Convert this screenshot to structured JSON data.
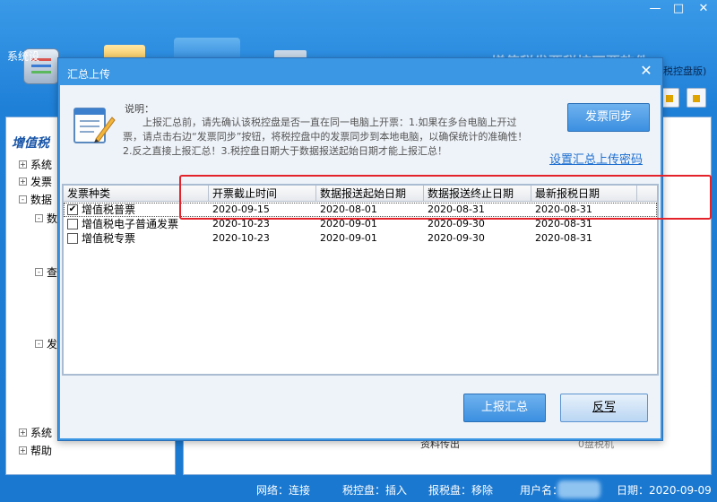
{
  "app": {
    "window_controls": [
      "—",
      "□",
      "✕"
    ],
    "toolbar": {
      "settings_label": "系统设"
    },
    "title": "增值税发票税控开票软件",
    "subtitle": "税控盘版)",
    "left_panel": {
      "heading": "增值税",
      "tree": [
        {
          "toggle": "+",
          "label": "系统"
        },
        {
          "toggle": "+",
          "label": "发票"
        },
        {
          "toggle": "-",
          "label": "数据"
        },
        {
          "toggle": "-",
          "label": "数"
        },
        {
          "toggle": "-",
          "label": "查"
        },
        {
          "toggle": "-",
          "label": "发"
        },
        {
          "toggle": "+",
          "label": "系统"
        },
        {
          "toggle": "+",
          "label": "帮助"
        }
      ]
    },
    "center_behind": {
      "text_1": "资料传出",
      "text_2": "0盘税机"
    },
    "status_bar": {
      "network": "网络：连接",
      "tax_disk": "税控盘：插入",
      "tax_report_disk": "报税盘：移除",
      "user": "用户名：",
      "date": "日期：2020-09-09"
    }
  },
  "dialog": {
    "title": "汇总上传",
    "close_glyph": "✕",
    "info_label": "说明：",
    "info_text": "上报汇总前，请先确认该税控盘是否一直在同一电脑上开票：1.如果在多台电脑上开过票，请点击右边“发票同步”按钮，将税控盘中的发票同步到本地电脑，以确保统计的准确性！2.反之直接上报汇总！3.税控盘日期大于数据报送起始日期才能上报汇总！",
    "sync_button": "发票同步",
    "set_password_link": "设置汇总上传密码",
    "table": {
      "columns": [
        "发票种类",
        "开票截止时间",
        "数据报送起始日期",
        "数据报送终止日期",
        "最新报税日期"
      ],
      "rows": [
        {
          "checked": "✔",
          "type": "增值税普票",
          "deadline": "2020-09-15",
          "start": "2020-08-01",
          "end": "2020-08-31",
          "latest": "2020-08-31"
        },
        {
          "checked": "",
          "type": "增值税电子普通发票",
          "deadline": "2020-10-23",
          "start": "2020-09-01",
          "end": "2020-09-30",
          "latest": "2020-08-31"
        },
        {
          "checked": "",
          "type": "增值税专票",
          "deadline": "2020-10-23",
          "start": "2020-09-01",
          "end": "2020-09-30",
          "latest": "2020-08-31"
        }
      ]
    },
    "report_button": "上报汇总",
    "rewrite_button": "反写"
  },
  "colors": {
    "accent": "#3b96e3",
    "highlight": "#e3222a",
    "link": "#1e6fd0"
  }
}
